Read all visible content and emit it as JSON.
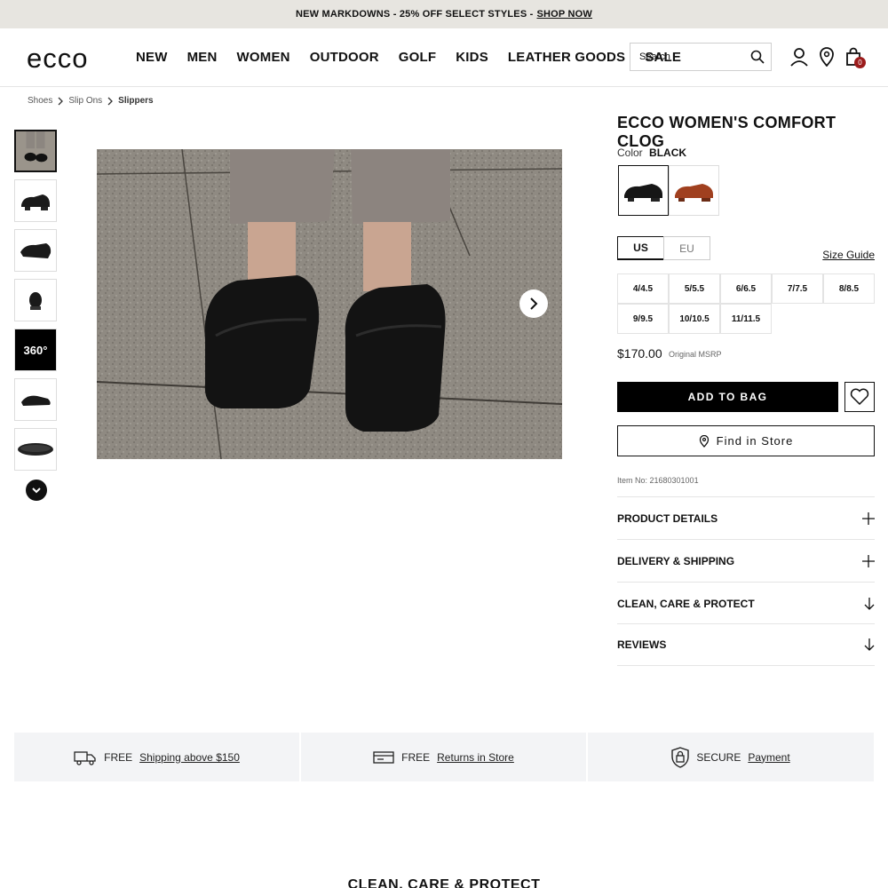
{
  "promo": {
    "text": "NEW MARKDOWNS - 25% OFF SELECT STYLES -",
    "link": "SHOP NOW"
  },
  "header": {
    "nav": [
      "NEW",
      "MEN",
      "WOMEN",
      "OUTDOOR",
      "GOLF",
      "KIDS",
      "LEATHER GOODS",
      "SALE"
    ],
    "search_placeholder": "Search",
    "bag_count": "0"
  },
  "breadcrumb": [
    "Shoes",
    "Slip Ons",
    "Slippers"
  ],
  "gallery": {
    "thumb_360_label": "360°"
  },
  "product": {
    "title": "ECCO WOMEN'S COMFORT CLOG",
    "color_label": "Color",
    "color_value": "BLACK",
    "units": [
      "US",
      "EU"
    ],
    "size_guide": "Size Guide",
    "sizes": [
      "4/4.5",
      "5/5.5",
      "6/6.5",
      "7/7.5",
      "8/8.5",
      "9/9.5",
      "10/10.5",
      "11/11.5"
    ],
    "price": "$170.00",
    "msrp_label": "Original MSRP",
    "add_to_bag": "ADD TO BAG",
    "find_in_store": "Find in Store",
    "item_no": "Item No: 21680301001",
    "accordions": [
      "PRODUCT DETAILS",
      "DELIVERY & SHIPPING",
      "CLEAN, CARE & PROTECT",
      "REVIEWS"
    ]
  },
  "usp": [
    {
      "prefix": "FREE",
      "link": "Shipping above $150"
    },
    {
      "prefix": "FREE",
      "link": "Returns in Store"
    },
    {
      "prefix": "SECURE",
      "link": "Payment"
    }
  ],
  "section_title": "CLEAN, CARE & PROTECT"
}
